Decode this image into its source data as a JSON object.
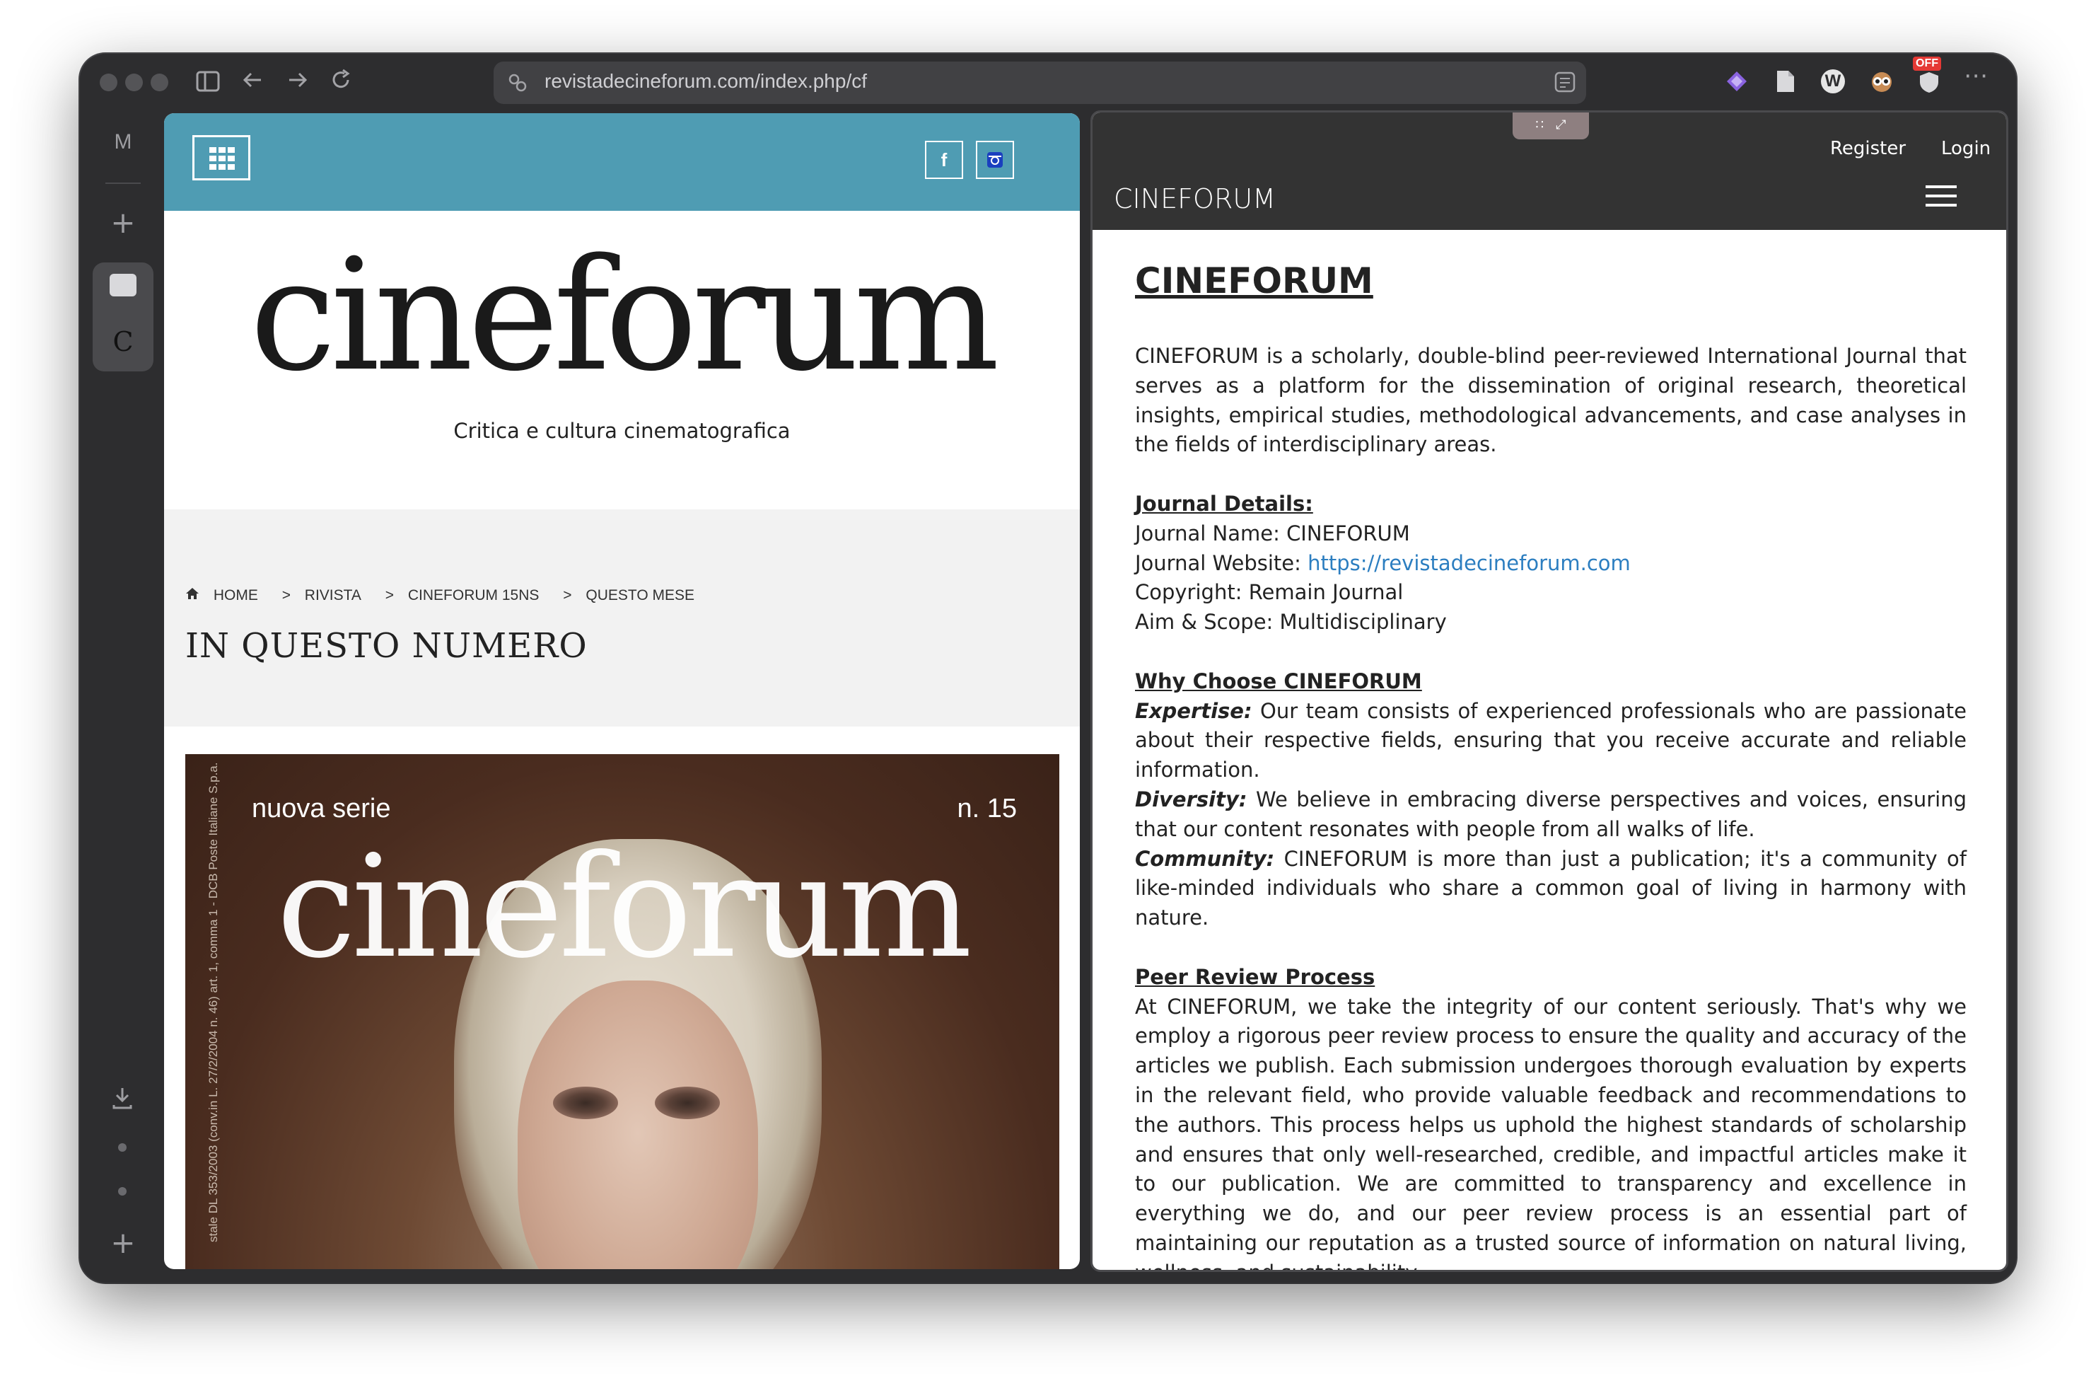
{
  "browser": {
    "url": "revistadecineforum.com/index.php/cf",
    "extensions": [
      "extension-diamond-icon",
      "extension-doc-icon",
      "extension-w-icon",
      "extension-owl-icon",
      "extension-off-icon"
    ],
    "ext_badge": "OFF",
    "sidebar": {
      "profile_letter": "M",
      "tab_letter": "C"
    }
  },
  "left_page": {
    "header_color": "#4f9cb3",
    "social": {
      "facebook": "f",
      "instagram": "◘"
    },
    "logo": "cineforum",
    "tagline": "Critica e cultura cinematografica",
    "breadcrumb": [
      "HOME",
      "RIVISTA",
      "CINEFORUM 15NS",
      "QUESTO MESE"
    ],
    "breadcrumb_sep": ">",
    "section_title": "IN QUESTO NUMERO",
    "cover": {
      "series": "nuova serie",
      "issue": "n. 15",
      "logo": "cineforum",
      "side_text": "stale DL 353/2003 (conv.in L. 27/2/2004 n. 46) art. 1, comma 1 - DCB Poste Italiane S.p.a."
    }
  },
  "right_page": {
    "nav": {
      "register": "Register",
      "login": "Login",
      "brand": "CINEFORUM"
    },
    "title": "CINEFORUM",
    "intro": "CINEFORUM is a scholarly, double-blind peer-reviewed International Journal that serves as a platform for the dissemination of original research, theoretical insights, empirical studies, methodological advancements, and case analyses in the fields of interdisciplinary areas.",
    "details_heading": "Journal Details:",
    "details": {
      "name_label": "Journal Name:",
      "name_value": "CINEFORUM",
      "website_label": "Journal Website:",
      "website_value": "https://revistadecineforum.com",
      "copyright_label": "Copyright:",
      "copyright_value": "Remain Journal",
      "aim_label": "Aim & Scope:",
      "aim_value": "Multidisciplinary"
    },
    "why_heading": "Why Choose CINEFORUM",
    "why": {
      "expertise_label": "Expertise:",
      "expertise_text": "Our team consists of experienced professionals who are passionate about their respective fields, ensuring that you receive accurate and reliable information.",
      "diversity_label": "Diversity:",
      "diversity_text": "We believe in embracing diverse perspectives and voices, ensuring that our content resonates with people from all walks of life.",
      "community_label": "Community:",
      "community_text": "CINEFORUM is more than just a publication; it's a community of like-minded individuals who share a common goal of living in harmony with nature."
    },
    "peer_heading": "Peer Review Process",
    "peer_text": "At CINEFORUM, we take the integrity of our content seriously. That's why we employ a rigorous peer review process to ensure the quality and accuracy of the articles we publish. Each submission undergoes thorough evaluation by experts in the relevant field, who provide valuable feedback and recommendations to the authors. This process helps us uphold the highest standards of scholarship and ensures that only well-researched, credible, and impactful articles make it to our publication. We are committed to transparency and excellence in everything we do, and our peer review process is an essential part of maintaining our reputation as a trusted source of information on natural living, wellness, and sustainability."
  }
}
